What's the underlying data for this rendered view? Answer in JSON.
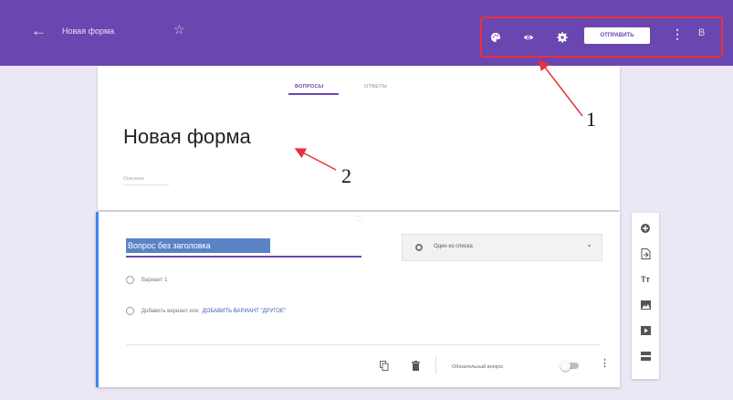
{
  "header": {
    "back_icon": "arrow-back-icon",
    "title": "Новая форма",
    "star_icon": "star-outline-icon",
    "toolbar_icons": [
      "palette-icon",
      "eye-preview-icon",
      "gear-icon"
    ],
    "send_label": "ОТПРАВИТЬ",
    "more_icon": "more-vert-icon",
    "account_icon": "account-icon",
    "accent_color": "#6a47b0"
  },
  "tabs": [
    {
      "label": "ВОПРОСЫ",
      "active": true
    },
    {
      "label": "ОТВЕТЫ",
      "active": false
    }
  ],
  "form": {
    "title": "Новая форма",
    "description_placeholder": "Описание"
  },
  "question": {
    "title": "Вопрос без заголовка",
    "type_label": "Один из списка",
    "options": [
      {
        "label": "Вариант 1"
      }
    ],
    "add_option_prefix": "Добавить вариант или",
    "add_other_label": "ДОБАВИТЬ ВАРИАНТ \"ДРУГОЕ\"",
    "required_label": "Обязательный вопрос",
    "required_on": false,
    "footer_icons": [
      "copy-icon",
      "trash-icon"
    ]
  },
  "sidebar": {
    "icons": [
      "add-question-icon",
      "import-questions-icon",
      "add-title-icon",
      "add-image-icon",
      "add-video-icon",
      "add-section-icon"
    ]
  },
  "callouts": {
    "label_1": "1",
    "label_2": "2",
    "highlight_color": "#e8323b"
  }
}
